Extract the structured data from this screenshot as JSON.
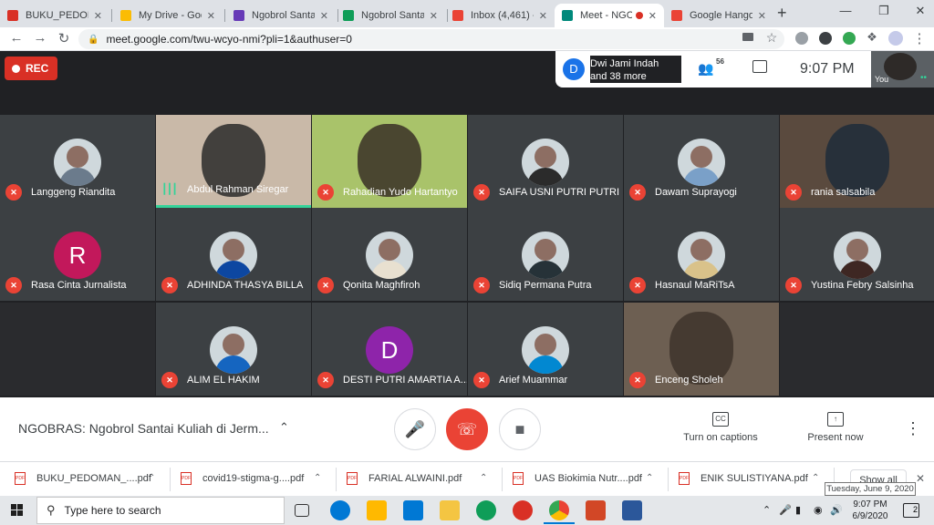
{
  "browser": {
    "tabs": [
      {
        "title": "BUKU_PEDOMA",
        "icon": "pdf-icon",
        "color": "#d93025"
      },
      {
        "title": "My Drive - Goo",
        "icon": "google-drive-icon",
        "color": "#fbbc04"
      },
      {
        "title": "Ngobrol Santai",
        "icon": "google-forms-icon",
        "color": "#673ab7"
      },
      {
        "title": "Ngobrol Santai",
        "icon": "google-sheets-icon",
        "color": "#0f9d58"
      },
      {
        "title": "Inbox (4,461) - ",
        "icon": "gmail-icon",
        "color": "#ea4335"
      },
      {
        "title": "Meet - NGO",
        "icon": "google-meet-icon",
        "color": "#00897b"
      },
      {
        "title": "Google Hangou",
        "icon": "gmail-icon",
        "color": "#ea4335"
      }
    ],
    "new_tab": "+",
    "url": "meet.google.com/twu-wcyo-nmi?pli=1&authuser=0"
  },
  "meet": {
    "rec_label": "REC",
    "info": {
      "avatar_letter": "D",
      "line1": "Dwi Jami Indah",
      "line2": "and 38 more",
      "participants_count": "56",
      "time": "9:07 PM"
    },
    "self_label": "You",
    "participants": [
      {
        "name": "Langgeng Riandita",
        "type": "photo",
        "muted": true,
        "bg": "#3c4043",
        "accent": "#6b7b8c"
      },
      {
        "name": "Abdul Rahman Siregar",
        "type": "video",
        "muted": false,
        "bg": "#c9b9a8",
        "accent": "#2a2a2a"
      },
      {
        "name": "Rahadian Yudo Hartantyo",
        "type": "video",
        "muted": true,
        "bg": "#a9c36a",
        "accent": "#3a3026"
      },
      {
        "name": "SAIFA USNI PUTRI PUTRI",
        "type": "photo",
        "muted": true,
        "bg": "#3c4043",
        "accent": "#2b2b2b"
      },
      {
        "name": "Dawam Suprayogi",
        "type": "photo",
        "muted": true,
        "bg": "#3c4043",
        "accent": "#7aa0c8"
      },
      {
        "name": "rania salsabila",
        "type": "video",
        "muted": true,
        "bg": "#5a4a3e",
        "accent": "#1e2b3a"
      },
      {
        "name": "Rasa Cinta Jurnalista",
        "type": "letter",
        "letter": "R",
        "muted": true,
        "bg": "#3c4043",
        "accent": "#c2185b"
      },
      {
        "name": "ADHINDA THASYA BILLA",
        "type": "photo",
        "muted": true,
        "bg": "#3c4043",
        "accent": "#0d47a1"
      },
      {
        "name": "Qonita Maghfiroh",
        "type": "photo",
        "muted": true,
        "bg": "#3c4043",
        "accent": "#e8e0d0"
      },
      {
        "name": "Sidiq Permana Putra",
        "type": "photo",
        "muted": true,
        "bg": "#3c4043",
        "accent": "#263238"
      },
      {
        "name": "Hasnaul MaRiTsA",
        "type": "photo",
        "muted": true,
        "bg": "#3c4043",
        "accent": "#d9c28a"
      },
      {
        "name": "Yustina Febry Salsinha",
        "type": "photo",
        "muted": true,
        "bg": "#3c4043",
        "accent": "#3e2723"
      },
      {
        "name": "ALIM EL HAKIM",
        "type": "photo",
        "muted": true,
        "bg": "#3c4043",
        "accent": "#1565c0"
      },
      {
        "name": "DESTI PUTRI AMARTIA A...",
        "type": "letter",
        "letter": "D",
        "muted": true,
        "bg": "#3c4043",
        "accent": "#8e24aa"
      },
      {
        "name": "Arief Muammar",
        "type": "photo",
        "muted": true,
        "bg": "#3c4043",
        "accent": "#0288d1"
      },
      {
        "name": "Enceng Sholeh",
        "type": "video",
        "muted": true,
        "bg": "#6d5f52",
        "accent": "#3e342c"
      }
    ]
  },
  "bottom_bar": {
    "meeting_name": "NGOBRAS: Ngobrol Santai Kuliah di Jerm...",
    "captions_label": "Turn on captions",
    "present_label": "Present now",
    "cc_text": "CC"
  },
  "downloads": {
    "items": [
      "BUKU_PEDOMAN_....pdf",
      "covid19-stigma-g....pdf",
      "FARIAL ALWAINI.pdf",
      "UAS Biokimia Nutr....pdf",
      "ENIK SULISTIYANA.pdf"
    ],
    "file_badge": "PDF",
    "show_all": "Show all",
    "tooltip": "Tuesday, June 9, 2020"
  },
  "taskbar": {
    "search_placeholder": "Type here to search",
    "time": "9:07 PM",
    "date": "6/9/2020",
    "notification_count": "2"
  }
}
